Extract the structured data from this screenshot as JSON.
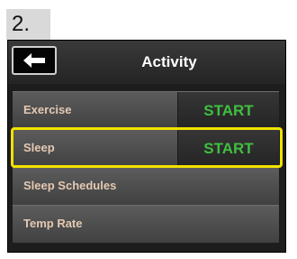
{
  "step_label": "2.",
  "header": {
    "title": "Activity",
    "back_icon": "back-arrow-icon"
  },
  "rows": [
    {
      "label": "Exercise",
      "action": "START"
    },
    {
      "label": "Sleep",
      "action": "START",
      "highlighted": true
    },
    {
      "label": "Sleep Schedules"
    },
    {
      "label": "Temp Rate"
    }
  ],
  "colors": {
    "action_text": "#3fbf3f",
    "row_label_text": "#e4c9b2",
    "highlight": "#f1e100",
    "title_text": "#ffffff"
  }
}
